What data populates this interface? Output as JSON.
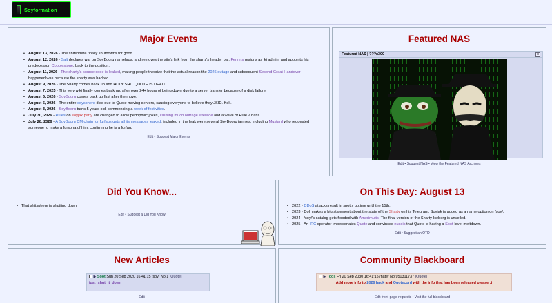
{
  "logo": {
    "text": "Soyformation"
  },
  "major_events": {
    "title": "Major Events",
    "items": [
      {
        "date": "August 13, 2026",
        "text": " - The shitsphere finally shutdowns for good"
      },
      {
        "date": "August 12, 2026",
        "pre": " - ",
        "link1": "Salt",
        "mid1": " declares war on SoyBooru namefags, and removes the site's link from the sharty's header bar. ",
        "link2": "Fenriris",
        "mid2": " resigns as 'ki admin, and appoints his predecessor, ",
        "link3": "Cobblestone",
        "post": ", back to the position."
      },
      {
        "date": "August 11, 2026",
        "pre": " - ",
        "link1": "The sharty's source code is leaked",
        "mid1": ", making people theorize that the actual reason the ",
        "link2": "2026 outage",
        "mid2": " and subsequent ",
        "link3": "Second Great Handover",
        "post": " happened was because the sharty was hacked."
      },
      {
        "date": "August 9, 2026",
        "text": " - The Sharty comes back up and HOLY SHIT QUOTE IS DEAD"
      },
      {
        "date": "August 7, 2025",
        "text": " - This very wiki finally comes back up, after over 24+ hours of being down due to a server transfer because of a disk failure."
      },
      {
        "date": "August 6, 2026",
        "pre": " - ",
        "link1": "SoyBooru",
        "post": " comes back up first after the move."
      },
      {
        "date": "August 5, 2026",
        "pre": " - The entire ",
        "link1": "soysphere",
        "post": " dies due to Quote moving servers, causing everyone to believe they JSID. Kek."
      },
      {
        "date": "August 3, 2026",
        "pre": " - ",
        "link1": "SoyBooru",
        "mid1": " turns 5 years old, commencing a ",
        "link2": "week of festivities",
        "post": "."
      },
      {
        "date": "July 30, 2026",
        "pre": " - ",
        "link1": "Rules",
        "mid1": " on ",
        "link2": "soyjak.party",
        "mid2": " are changed to allow pedophilic jokes, ",
        "link3": "causing much outrage sitewide",
        "post": " and a wave of Rule 2 bans."
      },
      {
        "date": "July 28, 2026",
        "pre": " - ",
        "link1": "A SoyBooru DM chain for furfags gets all its messages leaked",
        "mid1": "; included in the leak were several SoyBooru jannies, including ",
        "link2": "Mustard",
        "post": " who requested someone to make a fursona of him; confirming he is a furfag."
      }
    ],
    "footer": "Edit • Suggest Major Events"
  },
  "featured_nas": {
    "title": "Featured NAS",
    "window_title": "Featured NAS | ???x300",
    "close_label": "x",
    "footer": "Edit • Suggest NAS • View the Featured NAS Archives"
  },
  "did_you_know": {
    "title": "Did You Know...",
    "item": "That shitsphere is shutting down",
    "footer": "Edit • Suggest a Did You Know"
  },
  "on_this_day": {
    "title": "On This Day: August 13",
    "items": [
      {
        "pre": "2022 - ",
        "link1": "DDoS",
        "post": " attacks result in spotty uptime until the 15th."
      },
      {
        "pre": "2023 - Doll makes a big statement about the state of the ",
        "link1": "Sharty",
        "post": " on his Telegram. Soyjak is added as a name option on /soy/."
      },
      {
        "pre": "2024 - /soy/'s catalog gets flooded with ",
        "link1": "Amerimutts",
        "post": ". The final version of the Sharty Iceberg is unveiled."
      },
      {
        "pre": "2025 - An ",
        "link1": "IRC",
        "mid1": " operator impersonates ",
        "link2": "Quote",
        "mid2": " and convinces ",
        "link3": "nusois",
        "mid3": " that Quote is having a ",
        "link4": "Soot",
        "post": "-level meltdown."
      }
    ],
    "footer": "Edit • Suggest an OTD"
  },
  "new_articles": {
    "title": "New Articles",
    "post": {
      "name": "Soot",
      "date": "Sun 20 Sep 2020 16:41:15 /soy/ No.1",
      "reply": "[Quote]",
      "body": "just_shut_it_down"
    },
    "footer": "Edit"
  },
  "blackboard": {
    "title": "Community Blackboard",
    "post": {
      "name": "Toos",
      "date": "Fri 20 Sep 2030 16:41:15 /nate/ No 950311737",
      "reply": "[Quote]",
      "body_pre": "Add more info to ",
      "link1": "2026 hack",
      "body_mid": " and ",
      "link2": "Quotecord",
      "body_post": " with the info that has been released please :)"
    },
    "footer": "Edit front-page requests • Visit the full blackboard"
  },
  "colors": {
    "title_red": "#aa0000",
    "link": "#3366cc",
    "panel_bg": "#eef2ff",
    "post_bg": "#d6daf0"
  }
}
